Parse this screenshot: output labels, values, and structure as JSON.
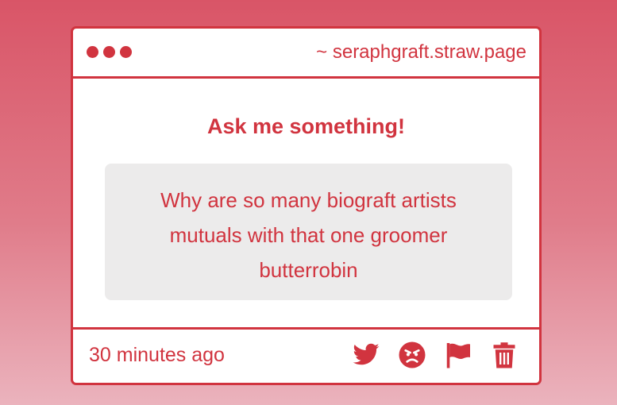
{
  "window": {
    "url": "~ seraphgraft.straw.page"
  },
  "main": {
    "heading": "Ask me something!",
    "question": "Why are so many biograft artists mutuals with that one groomer butterrobin"
  },
  "footer": {
    "timestamp": "30 minutes ago",
    "actions": [
      "twitter-icon",
      "angry-face-icon",
      "flag-icon",
      "trash-icon"
    ]
  },
  "colors": {
    "accent": "#d1343f",
    "background_top": "#d95567",
    "background_bottom": "#ebb3bd",
    "question_box": "#ecebeb"
  }
}
